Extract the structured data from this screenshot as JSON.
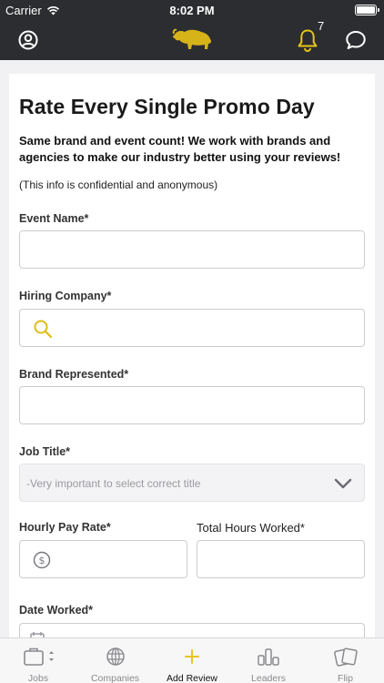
{
  "status_bar": {
    "carrier": "Carrier",
    "time": "8:02 PM"
  },
  "nav": {
    "notification_count": "7",
    "icons": [
      "profile-icon",
      "buffalo-logo-icon",
      "bell-icon",
      "chat-icon"
    ]
  },
  "form": {
    "title": "Rate Every Single Promo Day",
    "subtitle": "Same brand and event count! We work with brands and agencies to make our industry better using your reviews!",
    "note": "(This info is confidential and anonymous)",
    "event_name_label": "Event Name*",
    "event_name_value": "",
    "hiring_company_label": "Hiring Company*",
    "hiring_company_value": "",
    "brand_label": "Brand Represented*",
    "brand_value": "",
    "job_title_label": "Job Title*",
    "job_title_placeholder": "-Very important to select correct title",
    "hourly_pay_label": "Hourly Pay Rate*",
    "hourly_pay_value": "",
    "total_hours_label": "Total Hours Worked*",
    "total_hours_value": "",
    "date_worked_label": "Date Worked*"
  },
  "tabs": [
    {
      "label": "Jobs",
      "icon": "briefcase-icon"
    },
    {
      "label": "Companies",
      "icon": "globe-icon"
    },
    {
      "label": "Add Review",
      "icon": "plus-icon"
    },
    {
      "label": "Leaders",
      "icon": "leaders-icon"
    },
    {
      "label": "Flip",
      "icon": "cards-icon"
    }
  ],
  "colors": {
    "accent": "#e8c51a",
    "nav_bg": "#2b2d30",
    "page_bg": "#f1f1f4"
  }
}
